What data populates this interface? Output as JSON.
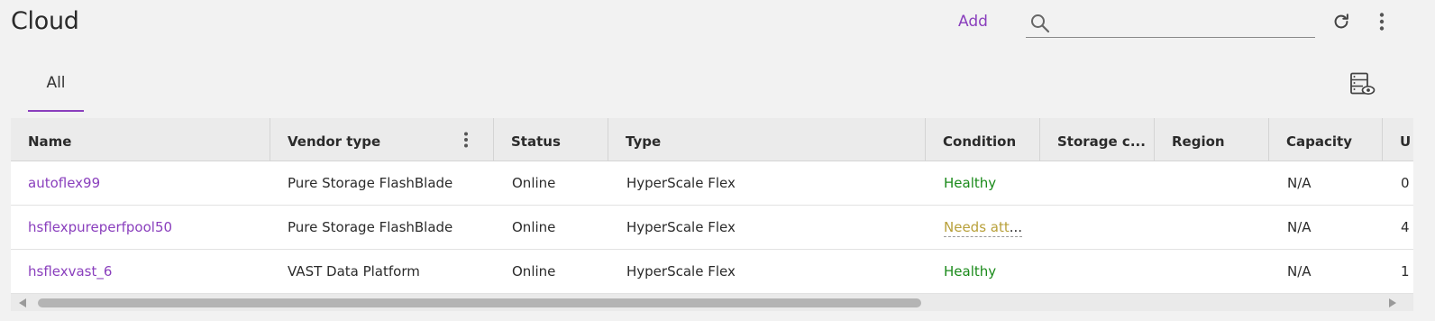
{
  "page": {
    "title": "Cloud"
  },
  "toolbar": {
    "add_label": "Add",
    "search_placeholder": "",
    "search_value": ""
  },
  "tabs": [
    {
      "label": "All",
      "active": true
    }
  ],
  "table": {
    "columns": [
      "Name",
      "Vendor type",
      "Status",
      "Type",
      "Condition",
      "Storage c...",
      "Region",
      "Capacity",
      "U"
    ],
    "rows": [
      {
        "name": "autoflex99",
        "vendor_type": "Pure Storage FlashBlade",
        "status": "Online",
        "type": "HyperScale Flex",
        "condition": "Healthy",
        "storage": "",
        "region": "",
        "capacity": "N/A",
        "u": "0"
      },
      {
        "name": "hsflexpureperfpool50",
        "vendor_type": "Pure Storage FlashBlade",
        "status": "Online",
        "type": "HyperScale Flex",
        "condition": "Needs att",
        "storage": "",
        "region": "",
        "capacity": "N/A",
        "u": "4"
      },
      {
        "name": "hsflexvast_6",
        "vendor_type": "VAST Data Platform",
        "status": "Online",
        "type": "HyperScale Flex",
        "condition": "Healthy",
        "storage": "",
        "region": "",
        "capacity": "N/A",
        "u": "1"
      }
    ]
  },
  "colors": {
    "accent": "#8a3fbd",
    "healthy": "#1a8a1a",
    "warning": "#b8a03a"
  },
  "icons": {
    "search": "search-icon",
    "refresh": "refresh-icon",
    "more": "more-vertical-icon",
    "view": "column-view-icon"
  }
}
